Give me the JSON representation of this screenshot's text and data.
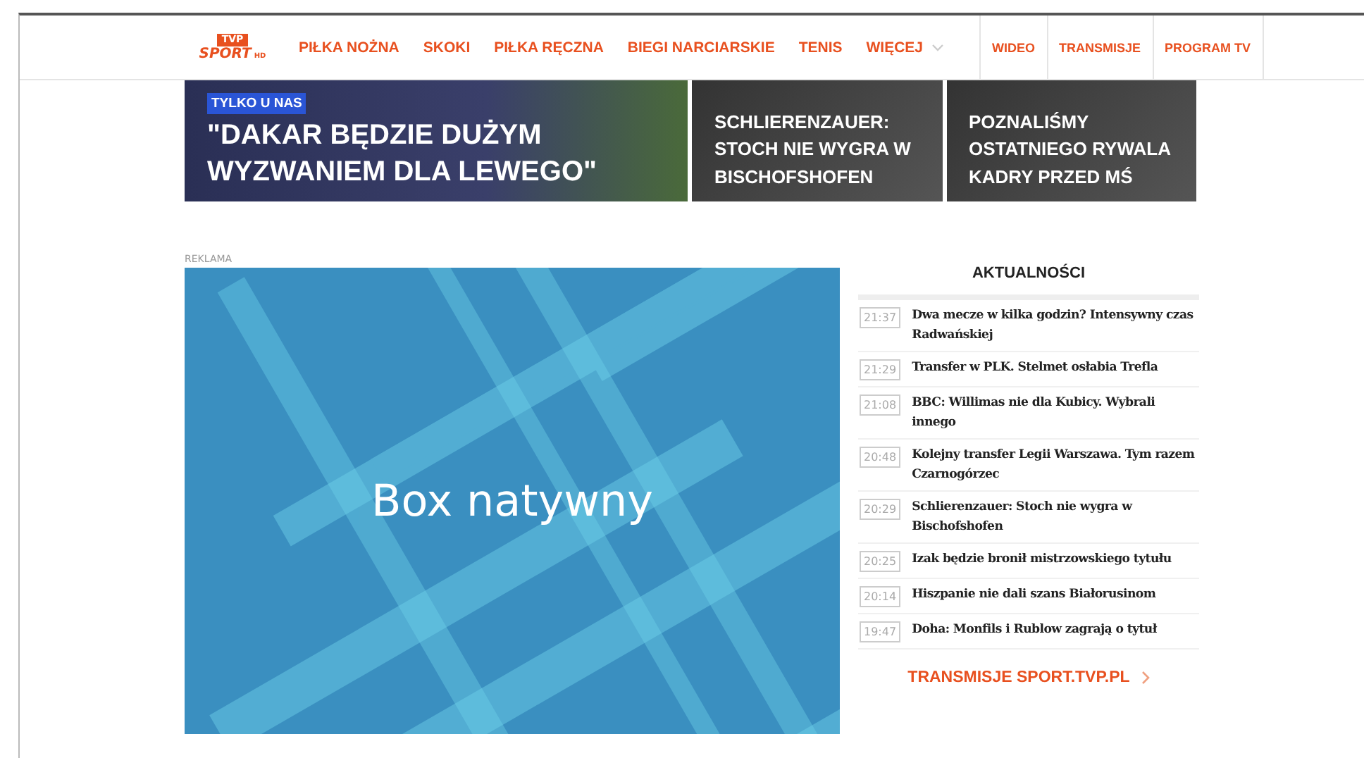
{
  "logo": {
    "badge": "TVP",
    "word": "SPORT",
    "suffix": "HD"
  },
  "nav": {
    "items": [
      {
        "label": "PIŁKA NOŻNA",
        "kind": "link"
      },
      {
        "label": "SKOKI",
        "kind": "link"
      },
      {
        "label": "PIŁKA RĘCZNA",
        "kind": "link"
      },
      {
        "label": "BIEGI NARCIARSKIE",
        "kind": "link"
      },
      {
        "label": "TENIS",
        "kind": "link"
      },
      {
        "label": "WIĘCEJ",
        "kind": "dropdown"
      }
    ],
    "boxed": [
      "WIDEO",
      "TRANSMISJE",
      "PROGRAM TV"
    ]
  },
  "hero": [
    {
      "badge": "TYLKO U NAS",
      "title": "\"DAKAR BĘDZIE DUŻYM WYZWANIEM DLA LEWEGO\"",
      "kind": "big"
    },
    {
      "title": "SCHLIERENZAUER: STOCH NIE WYGRA W BISCHOFSHOFEN",
      "kind": "small"
    },
    {
      "title": "POZNALIŚMY OSTATNIEGO RYWALA KADRY PRZED MŚ",
      "kind": "small"
    }
  ],
  "ad": {
    "label": "REKLAMA",
    "text": "Box natywny"
  },
  "news": {
    "title": "AKTUALNOŚCI",
    "items": [
      {
        "time": "21:37",
        "text": "Dwa mecze w kilka godzin? Intensywny czas Radwańskiej"
      },
      {
        "time": "21:29",
        "text": "Transfer w PLK. Stelmet osłabia Trefla"
      },
      {
        "time": "21:08",
        "text": "BBC: Willimas nie dla Kubicy. Wybrali innego"
      },
      {
        "time": "20:48",
        "text": "Kolejny transfer Legii Warszawa. Tym razem Czarnogórzec"
      },
      {
        "time": "20:29",
        "text": "Schlierenzauer: Stoch nie wygra w Bischofshofen"
      },
      {
        "time": "20:25",
        "text": "Izak będzie bronił mistrzowskiego tytułu"
      },
      {
        "time": "20:14",
        "text": "Hiszpanie nie dali szans Białorusinom"
      },
      {
        "time": "19:47",
        "text": "Doha: Monfils i Rublow zagrają o tytuł"
      }
    ],
    "more": "TRANSMISJE SPORT.TVP.PL"
  }
}
